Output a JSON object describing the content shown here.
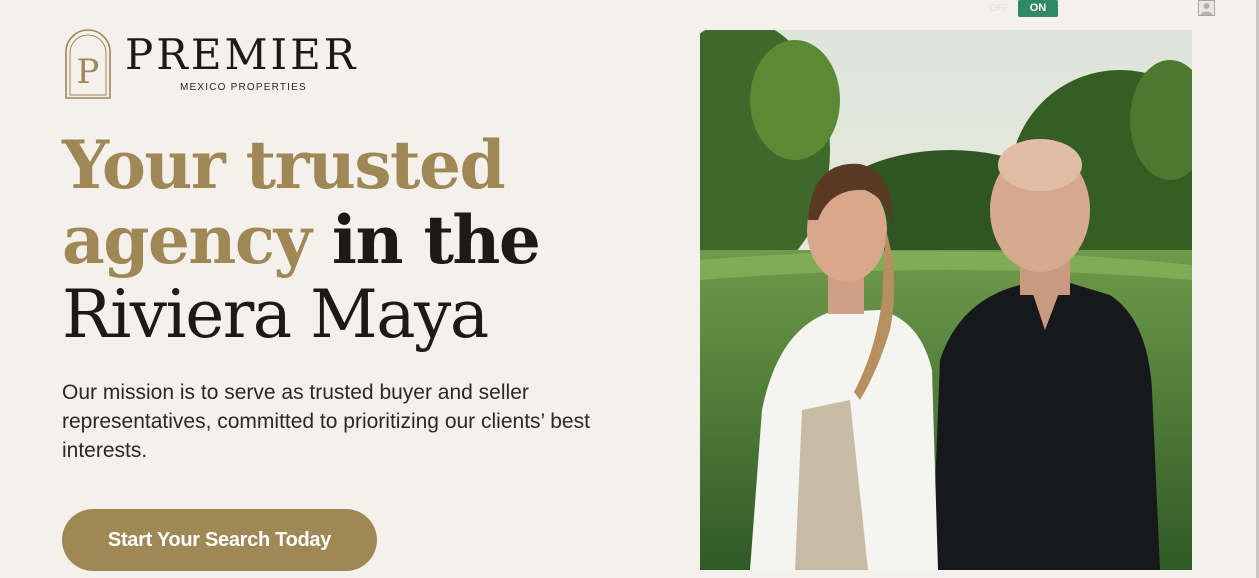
{
  "toggle": {
    "off_label": "OFF",
    "on_label": "ON"
  },
  "brand": {
    "name": "PREMIER",
    "tagline": "MEXICO PROPERTIES",
    "monogram": "P"
  },
  "hero": {
    "headline_part1": "Your trusted",
    "headline_part2": "agency",
    "headline_part3": " in the",
    "headline_part4": "Riviera Maya",
    "mission": "Our mission is to serve as trusted buyer and seller representatives, committed to prioritizing our clients’ best interests.",
    "cta_label": "Start Your Search Today"
  },
  "colors": {
    "background": "#f4f1ec",
    "gold": "#a08856",
    "dark": "#1c1a17",
    "toggle_on": "#2f8a63"
  },
  "icons": {
    "user": "user-icon",
    "logo": "logo-monogram"
  }
}
